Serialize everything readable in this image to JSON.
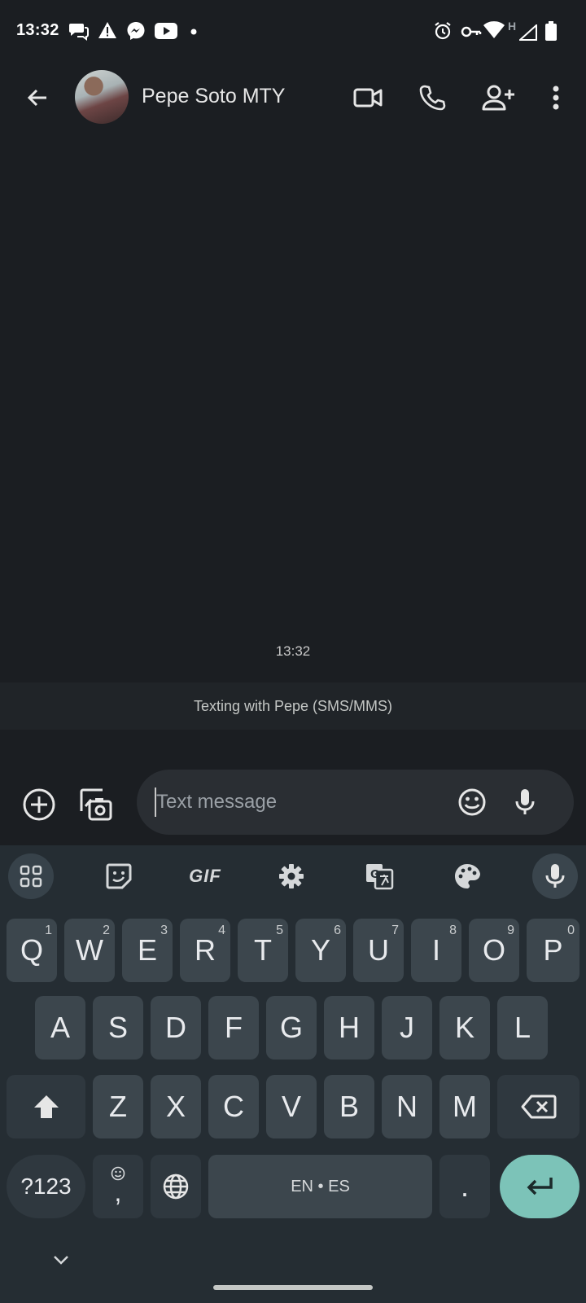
{
  "status_bar": {
    "time": "13:32",
    "network_type": "H"
  },
  "header": {
    "contact_name": "Pepe Soto MTY"
  },
  "conversation": {
    "timestamp": "13:32",
    "sms_banner": "Texting with Pepe (SMS/MMS)"
  },
  "compose": {
    "placeholder": "Text message"
  },
  "keyboard": {
    "toolbar": {
      "gif_label": "GIF"
    },
    "row1": [
      {
        "label": "Q",
        "hint": "1"
      },
      {
        "label": "W",
        "hint": "2"
      },
      {
        "label": "E",
        "hint": "3"
      },
      {
        "label": "R",
        "hint": "4"
      },
      {
        "label": "T",
        "hint": "5"
      },
      {
        "label": "Y",
        "hint": "6"
      },
      {
        "label": "U",
        "hint": "7"
      },
      {
        "label": "I",
        "hint": "8"
      },
      {
        "label": "O",
        "hint": "9"
      },
      {
        "label": "P",
        "hint": "0"
      }
    ],
    "row2": [
      {
        "label": "A"
      },
      {
        "label": "S"
      },
      {
        "label": "D"
      },
      {
        "label": "F"
      },
      {
        "label": "G"
      },
      {
        "label": "H"
      },
      {
        "label": "J"
      },
      {
        "label": "K"
      },
      {
        "label": "L"
      }
    ],
    "row3": [
      {
        "label": "Z"
      },
      {
        "label": "X"
      },
      {
        "label": "C"
      },
      {
        "label": "V"
      },
      {
        "label": "B"
      },
      {
        "label": "N"
      },
      {
        "label": "M"
      }
    ],
    "symbols_label": "?123",
    "comma_label": ",",
    "space_label": "EN • ES",
    "period_label": "."
  },
  "colors": {
    "background": "#1b1e22",
    "keyboard": "#252d33",
    "key": "#3c464d",
    "enter_accent": "#7cc3b8"
  }
}
